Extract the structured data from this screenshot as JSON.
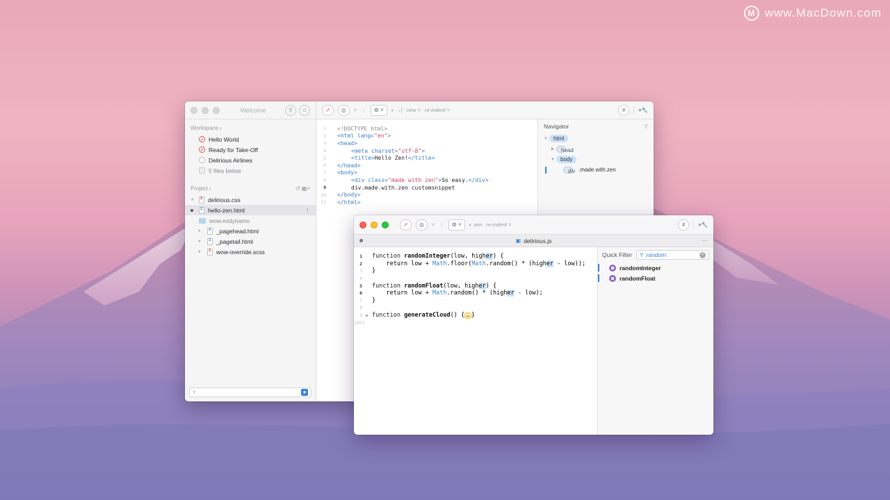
{
  "watermark": "www.MacDown.com",
  "sidebar": {
    "title": "Welcome",
    "workspace_label": "Workspace",
    "workspace_items": [
      {
        "label": "Hello World"
      },
      {
        "label": "Ready for Take-Off"
      },
      {
        "label": "Delirious Airlines"
      },
      {
        "label": "5 files below"
      }
    ],
    "project_label": "Project",
    "project_items": [
      {
        "label": "delirious.css"
      },
      {
        "label": "hello-zen.html"
      },
      {
        "label": "wow.esdynamo"
      },
      {
        "label": "_pagehead.html"
      },
      {
        "label": "_pagetail.html"
      },
      {
        "label": "wow-override.scss"
      }
    ]
  },
  "toolbar1": {
    "new_label": "new",
    "reindent_label": "re-indent",
    "hash_label": "#"
  },
  "editor1": {
    "lines": [
      {
        "n": "1"
      },
      {
        "n": "2"
      },
      {
        "n": "3"
      },
      {
        "n": "4"
      },
      {
        "n": "5"
      },
      {
        "n": "6"
      },
      {
        "n": "7"
      },
      {
        "n": "8"
      },
      {
        "n": "9"
      },
      {
        "n": "10"
      },
      {
        "n": "11"
      }
    ],
    "code": {
      "l1": "<!DOCTYPE html>",
      "l2a": "<html ",
      "l2b": "lang=",
      "l2c": "\"en\"",
      "l2d": ">",
      "l3": "<head>",
      "l4a": "<meta ",
      "l4b": "charset=",
      "l4c": "\"utf-8\"",
      "l4d": ">",
      "l5a": "<title>",
      "l5b": "Hello Zen!",
      "l5c": "</title>",
      "l6": "</head>",
      "l7": "<body>",
      "l8a": "<div ",
      "l8b": "class=",
      "l8c": "\"made with zen\"",
      "l8d": ">",
      "l8e": "So easy.",
      "l8f": "</div>",
      "l9": "div.made.with.zen customsnippet",
      "l10": "</body>",
      "l11": "</html>"
    }
  },
  "navigator": {
    "title": "Navigator",
    "nodes": {
      "html": "html",
      "head": "head",
      "body": "body",
      "div": "div",
      "div_class": ".made.with.zen"
    }
  },
  "window2": {
    "filename": "delirious.js",
    "toolbar": {
      "zen_label": "zen",
      "reindent_label": "re-indent",
      "hash_label": "#"
    },
    "code": {
      "n1": "1",
      "n2": "2",
      "n3": "3",
      "n4": "4",
      "n5": "5",
      "n6": "6",
      "n7": "7",
      "n8": "8",
      "n9": "9",
      "n10": "1001",
      "l1a": "function ",
      "l1b": "randomInteger",
      "l1c": "(low, high",
      "l1d": "er",
      "l1e": ") {",
      "l2a": "    return low + ",
      "l2b": "Math",
      "l2c": ".floor(",
      "l2d": "Math",
      "l2e": ".random() * (high",
      "l2f": "er",
      "l2g": " - low));",
      "l3": "}",
      "l5a": "function ",
      "l5b": "randomFloat",
      "l5c": "(low, high",
      "l5d": "er",
      "l5e": ") {",
      "l6a": "    return low + ",
      "l6b": "Math",
      "l6c": ".random() * (high",
      "l6d": "er",
      "l6e": " - low);",
      "l7": "}",
      "l9a": "function ",
      "l9b": "generateCloud",
      "l9c": "() {",
      "l9d": "…",
      "l9e": "}"
    },
    "quick_filter": {
      "label": "Quick Filter",
      "value": "random",
      "results": [
        {
          "label": "randomInteger"
        },
        {
          "label": "randomFloat"
        }
      ]
    }
  }
}
